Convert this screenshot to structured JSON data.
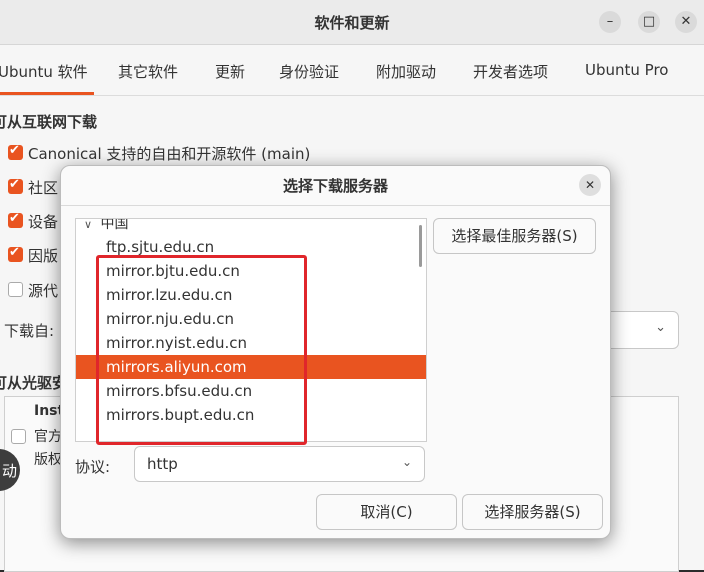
{
  "window": {
    "title": "软件和更新",
    "controls": {
      "minimize": "–",
      "maximize": "□",
      "close": "✕"
    }
  },
  "tabs": [
    "Ubuntu 软件",
    "其它软件",
    "更新",
    "身份验证",
    "附加驱动",
    "开发者选项",
    "Ubuntu Pro"
  ],
  "main": {
    "internet_section": "可从互联网下载",
    "checkboxes": [
      {
        "label": "Canonical 支持的自由和开源软件 (main)",
        "checked": true
      },
      {
        "label": "社区",
        "checked": true
      },
      {
        "label": "设备",
        "checked": true
      },
      {
        "label": "因版",
        "checked": true
      },
      {
        "label": "源代",
        "checked": false
      }
    ],
    "download_from_label": "下载自:",
    "cdrom_section": "可从光驱安",
    "cdrom_item_title": "Inst",
    "cdrom_item_line1": "官方",
    "cdrom_item_line2": "版权",
    "side_button": "动"
  },
  "dialog": {
    "title": "选择下载服务器",
    "close": "✕",
    "tree_group": "中国",
    "servers": [
      "ftp.sjtu.edu.cn",
      "mirror.bjtu.edu.cn",
      "mirror.lzu.edu.cn",
      "mirror.nju.edu.cn",
      "mirror.nyist.edu.cn",
      "mirrors.aliyun.com",
      "mirrors.bfsu.edu.cn",
      "mirrors.bupt.edu.cn"
    ],
    "selected_server": "mirrors.aliyun.com",
    "best_server_button": "选择最佳服务器(S)",
    "protocol_label": "协议:",
    "protocol_value": "http",
    "cancel_button": "取消(C)",
    "select_button": "选择服务器(S)"
  },
  "colors": {
    "accent": "#e95420",
    "highlight_box": "#e0262b"
  }
}
